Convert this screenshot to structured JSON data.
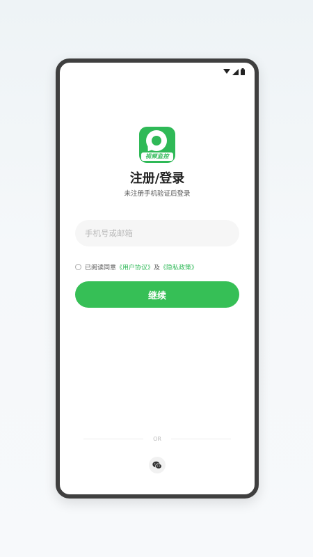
{
  "app": {
    "logo_text": "视频监控",
    "title": "注册/登录",
    "subtitle": "未注册手机验证后登录"
  },
  "login": {
    "account_placeholder": "手机号或邮箱",
    "account_value": "",
    "agree_prefix": "已阅读同意",
    "user_agreement": "《用户协议》",
    "and": "及",
    "privacy_policy": "《隐私政策》",
    "agree_checked": false,
    "continue_label": "继续"
  },
  "alt_login": {
    "or_label": "OR",
    "wechat_icon": "wechat-icon"
  },
  "colors": {
    "accent": "#36bf56",
    "frame": "#3f3f3f"
  }
}
